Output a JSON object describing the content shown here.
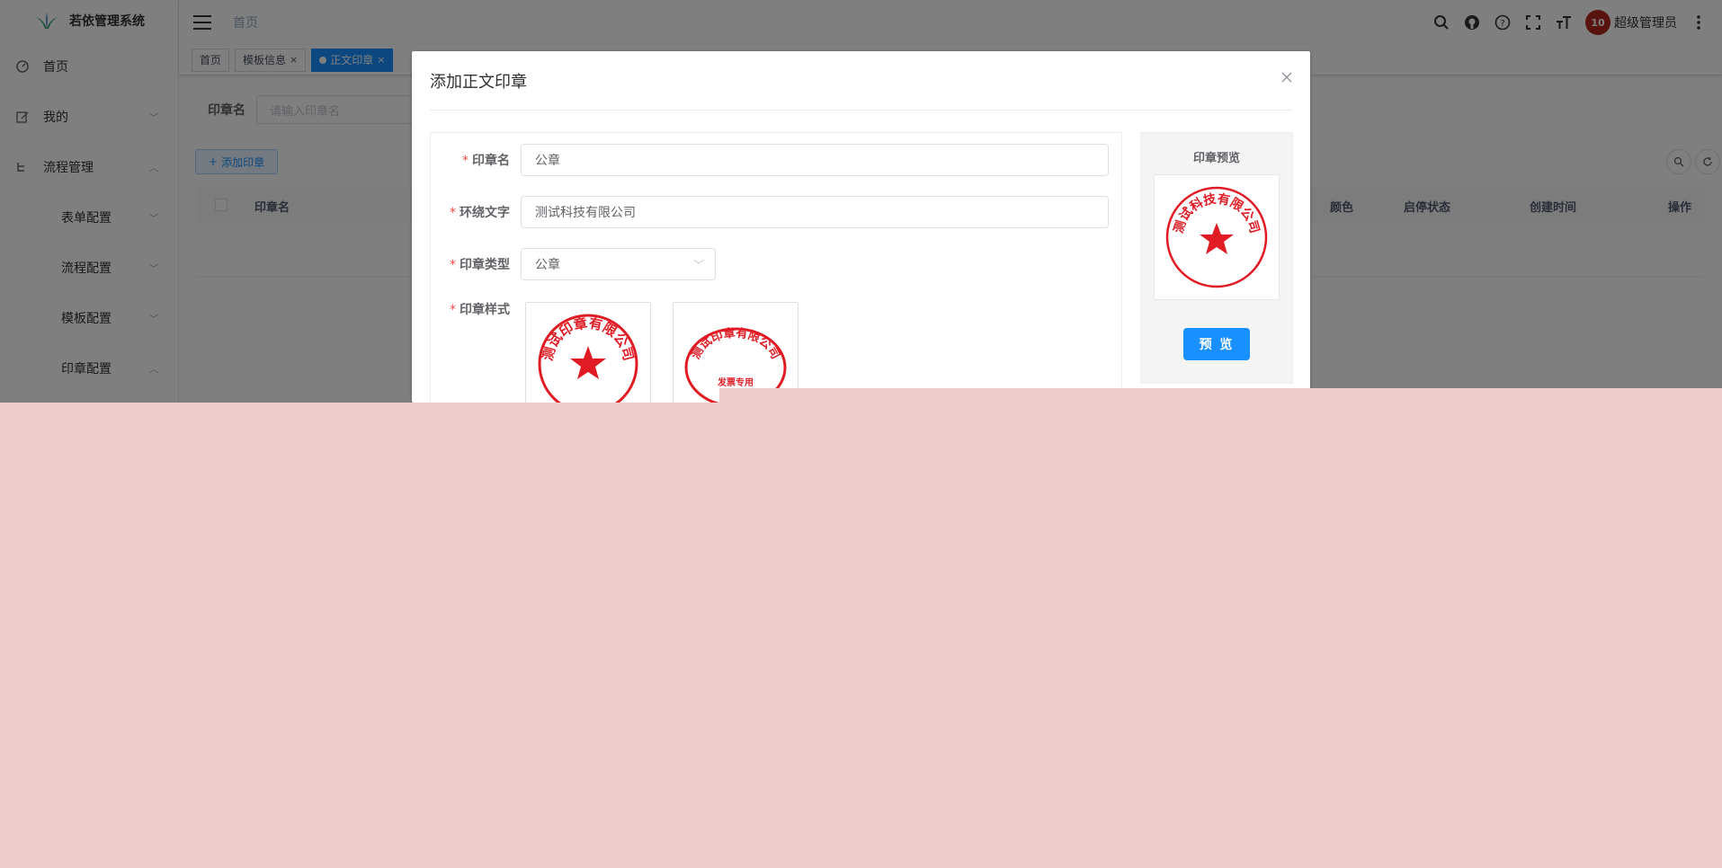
{
  "app": {
    "title": "若依管理系统"
  },
  "sidebar": {
    "items": [
      {
        "label": "首页",
        "icon": "dashboard-icon",
        "has_chevron": false
      },
      {
        "label": "我的",
        "icon": "edit-icon",
        "has_chevron": true,
        "chevron": "down"
      },
      {
        "label": "流程管理",
        "icon": "tree-icon",
        "has_chevron": true,
        "chevron": "up"
      },
      {
        "label": "表单配置",
        "sub": true,
        "has_chevron": true,
        "chevron": "down"
      },
      {
        "label": "流程配置",
        "sub": true,
        "has_chevron": true,
        "chevron": "down"
      },
      {
        "label": "模板配置",
        "sub": true,
        "has_chevron": true,
        "chevron": "down"
      },
      {
        "label": "印章配置",
        "sub": true,
        "has_chevron": true,
        "chevron": "up"
      }
    ]
  },
  "navbar": {
    "breadcrumb": "首页",
    "username": "超级管理员",
    "avatar_text": "10"
  },
  "tags": [
    {
      "label": "首页",
      "active": false,
      "closable": false
    },
    {
      "label": "模板信息",
      "active": false,
      "closable": true
    },
    {
      "label": "正文印章",
      "active": true,
      "closable": true
    }
  ],
  "search": {
    "label": "印章名",
    "placeholder": "请输入印章名"
  },
  "toolbar": {
    "add_label": "添加印章"
  },
  "table": {
    "columns": [
      "印章名",
      "颜色",
      "启停状态",
      "创建时间",
      "操作"
    ]
  },
  "dialog": {
    "title": "添加正文印章",
    "form": {
      "name_label": "印章名",
      "name_value": "公章",
      "text_label": "环绕文字",
      "text_value": "测试科技有限公司",
      "type_label": "印章类型",
      "type_value": "公章",
      "style_label": "印章样式"
    },
    "styles": [
      {
        "text": "测试印章有限公司",
        "center": "★"
      },
      {
        "text": "测试印章有限公司",
        "center": "发票专用"
      }
    ],
    "preview": {
      "title": "印章预览",
      "seal_text": "测试科技有限公司",
      "button": "预 览"
    }
  },
  "colors": {
    "primary": "#1890ff",
    "seal_red": "#e01b24",
    "overlay": "rgba(0,0,0,0.5)",
    "pink": "#edcbcb"
  }
}
